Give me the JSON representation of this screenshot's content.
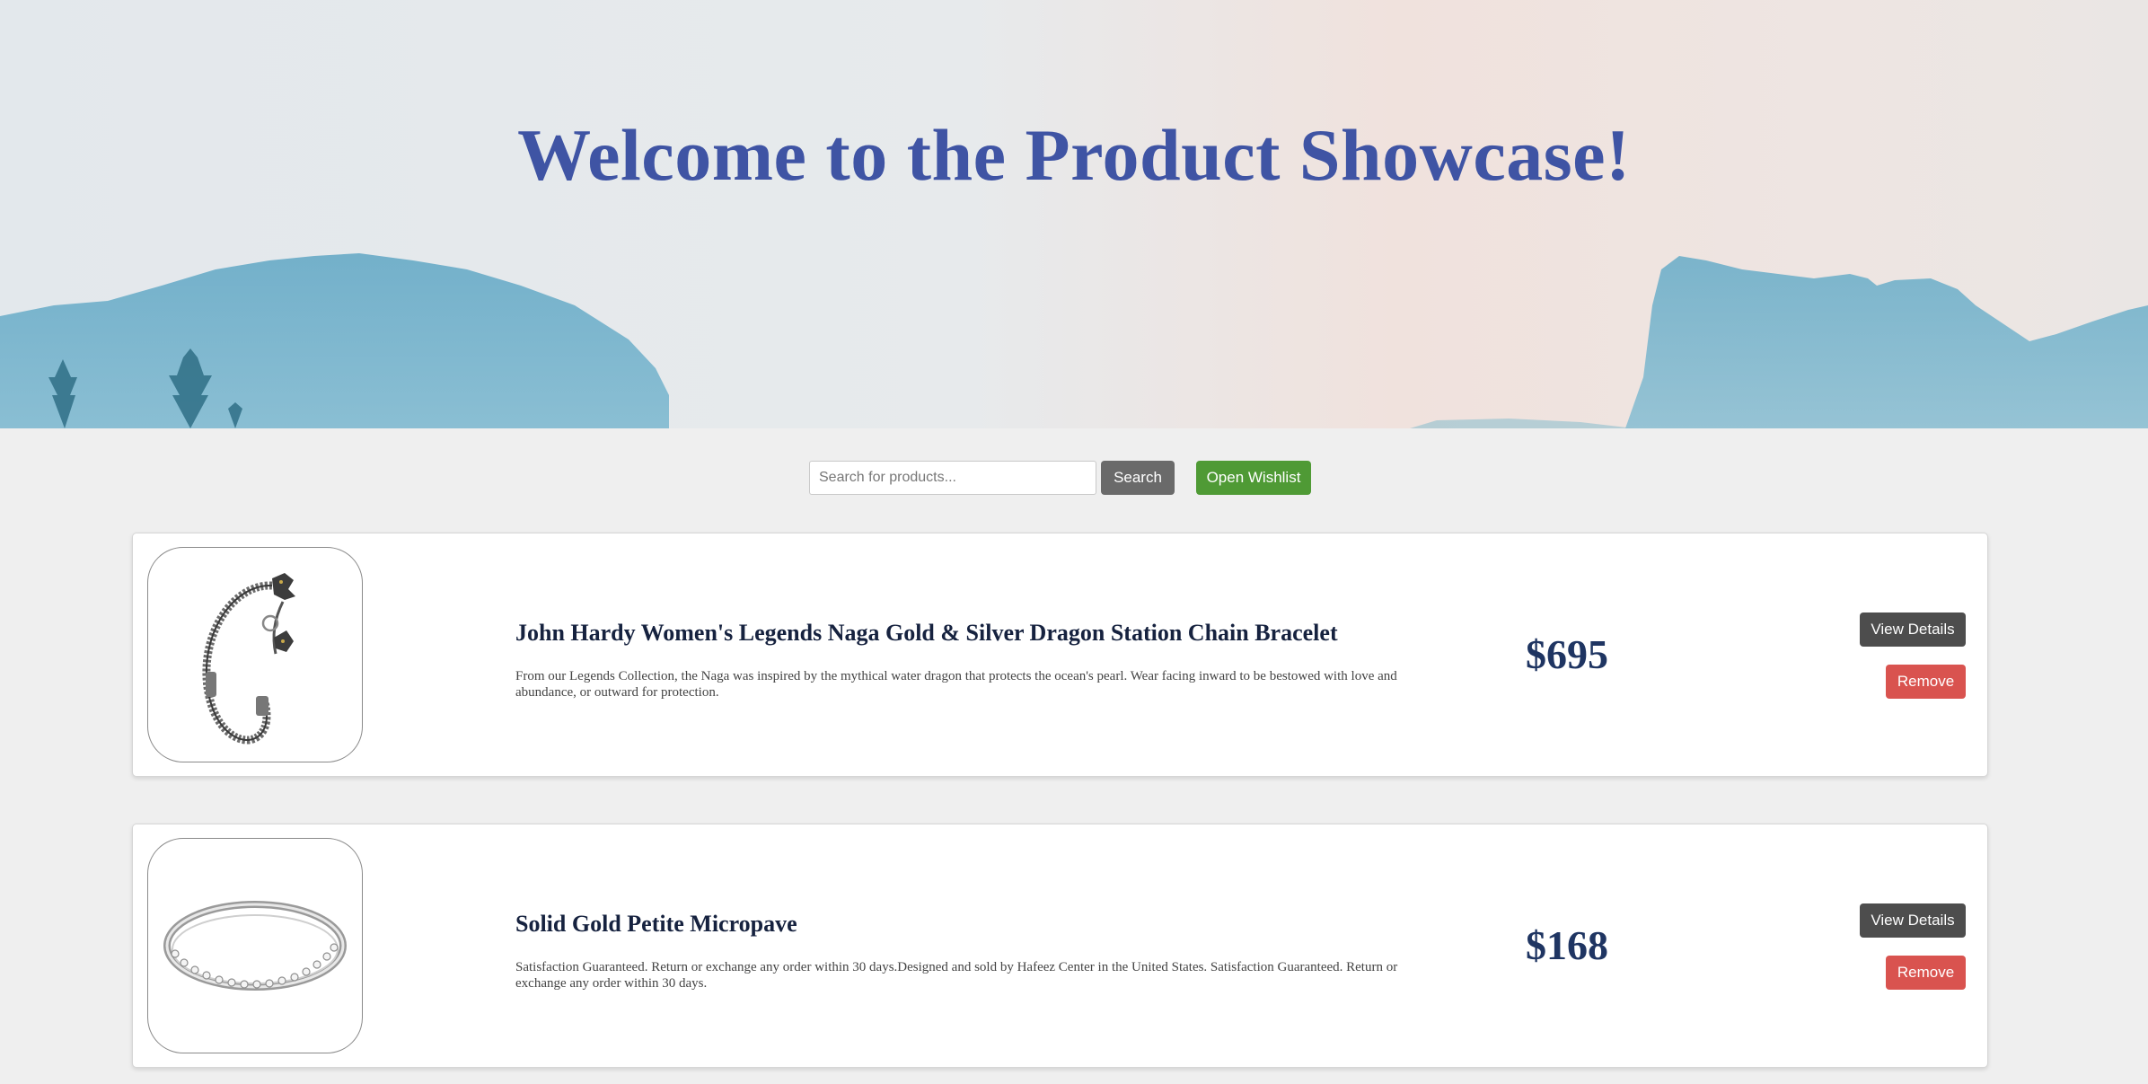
{
  "hero": {
    "title": "Welcome to the Product Showcase!"
  },
  "search": {
    "placeholder": "Search for products...",
    "value": "",
    "button_label": "Search"
  },
  "wishlist": {
    "button_label": "Open Wishlist"
  },
  "products": [
    {
      "title": "John Hardy Women's Legends Naga Gold & Silver Dragon Station Chain Bracelet",
      "description": "From our Legends Collection, the Naga was inspired by the mythical water dragon that protects the ocean's pearl. Wear facing inward to be bestowed with love and abundance, or outward for protection.",
      "price": "$695",
      "details_label": "View Details",
      "remove_label": "Remove"
    },
    {
      "title": "Solid Gold Petite Micropave",
      "description": "Satisfaction Guaranteed. Return or exchange any order within 30 days.Designed and sold by Hafeez Center in the United States. Satisfaction Guaranteed. Return or exchange any order within 30 days.",
      "price": "$168",
      "details_label": "View Details",
      "remove_label": "Remove"
    }
  ],
  "colors": {
    "hero_title": "#3f54a4",
    "search_button": "#6a6a6a",
    "wishlist_button": "#4f9a35",
    "details_button": "#4d4d4d",
    "remove_button": "#d9534f",
    "price": "#1f3562"
  }
}
